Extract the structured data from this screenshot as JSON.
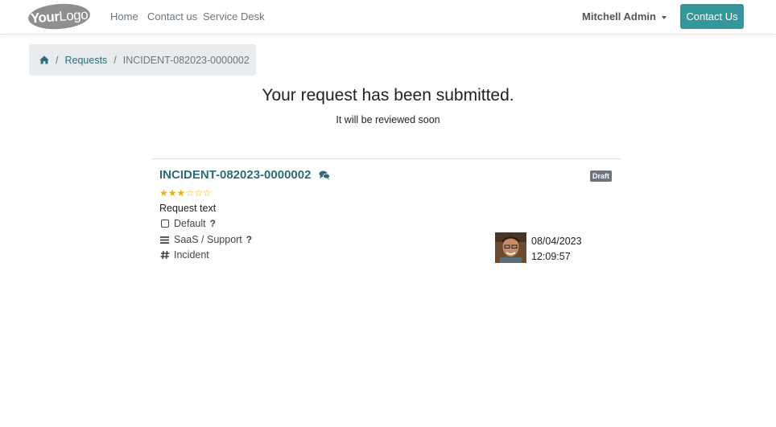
{
  "header": {
    "logo": {
      "bold": "Your",
      "thin": "Logo"
    },
    "nav": [
      "Home",
      "Contact us",
      "Service Desk"
    ],
    "user_name": "Mitchell Admin",
    "contact_button": "Contact Us",
    "accent_color": "#35979c"
  },
  "breadcrumb": {
    "home_icon": "home-icon",
    "items": [
      "Requests",
      "INCIDENT-082023-0000002"
    ]
  },
  "message": {
    "title": "Your request has been submitted.",
    "subtitle": "It will be reviewed soon"
  },
  "ticket": {
    "name": "INCIDENT-082023-0000002",
    "status": "Draft",
    "rating": 3,
    "rating_max": 6,
    "description": "Request text",
    "fields": [
      {
        "icon": "checkbox-icon",
        "label": "Default",
        "help": "?"
      },
      {
        "icon": "list-icon",
        "label": "SaaS / Support",
        "help": "?"
      },
      {
        "icon": "hash-icon",
        "label": "Incident"
      }
    ],
    "date": "08/04/2023",
    "time": "12:09:57"
  }
}
